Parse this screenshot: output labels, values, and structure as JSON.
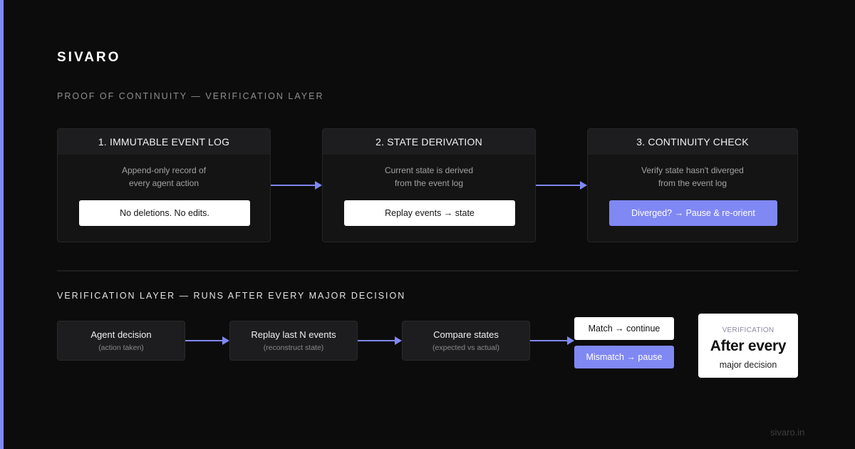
{
  "brand": {
    "name": "SIVARO",
    "url": "sivaro.in"
  },
  "colors": {
    "background": "#0c0c0c",
    "accent": "#8088f4",
    "card": "#141414",
    "card_header": "#1d1d1f",
    "pill": "#ffffff"
  },
  "proof": {
    "label": "PROOF OF CONTINUITY — VERIFICATION LAYER",
    "steps": [
      {
        "title": "1. IMMUTABLE EVENT LOG",
        "desc_lines": [
          "Append-only record of",
          "every agent action"
        ],
        "pill": "No deletions. No edits.",
        "pill_style": "white"
      },
      {
        "title": "2. STATE DERIVATION",
        "desc_lines": [
          "Current state is derived",
          "from the event log"
        ],
        "pill": "Replay events → state",
        "pill_style": "white"
      },
      {
        "title": "3. CONTINUITY CHECK",
        "desc_lines": [
          "Verify state hasn't diverged",
          "from the event log"
        ],
        "pill": "Diverged? → Pause & re-orient",
        "pill_style": "accent"
      }
    ]
  },
  "verification": {
    "label": "VERIFICATION LAYER — RUNS AFTER EVERY MAJOR DECISION",
    "flow": [
      {
        "title": "Agent decision",
        "sub": "(action taken)"
      },
      {
        "title": "Replay last N events",
        "sub": "(reconstruct state)"
      },
      {
        "title": "Compare states",
        "sub": "(expected vs actual)"
      }
    ],
    "outcomes": {
      "match": "Match → continue",
      "mismatch": "Mismatch → pause"
    },
    "badge": {
      "eyebrow": "VERIFICATION",
      "headline": "After every",
      "sub": "major decision"
    }
  }
}
